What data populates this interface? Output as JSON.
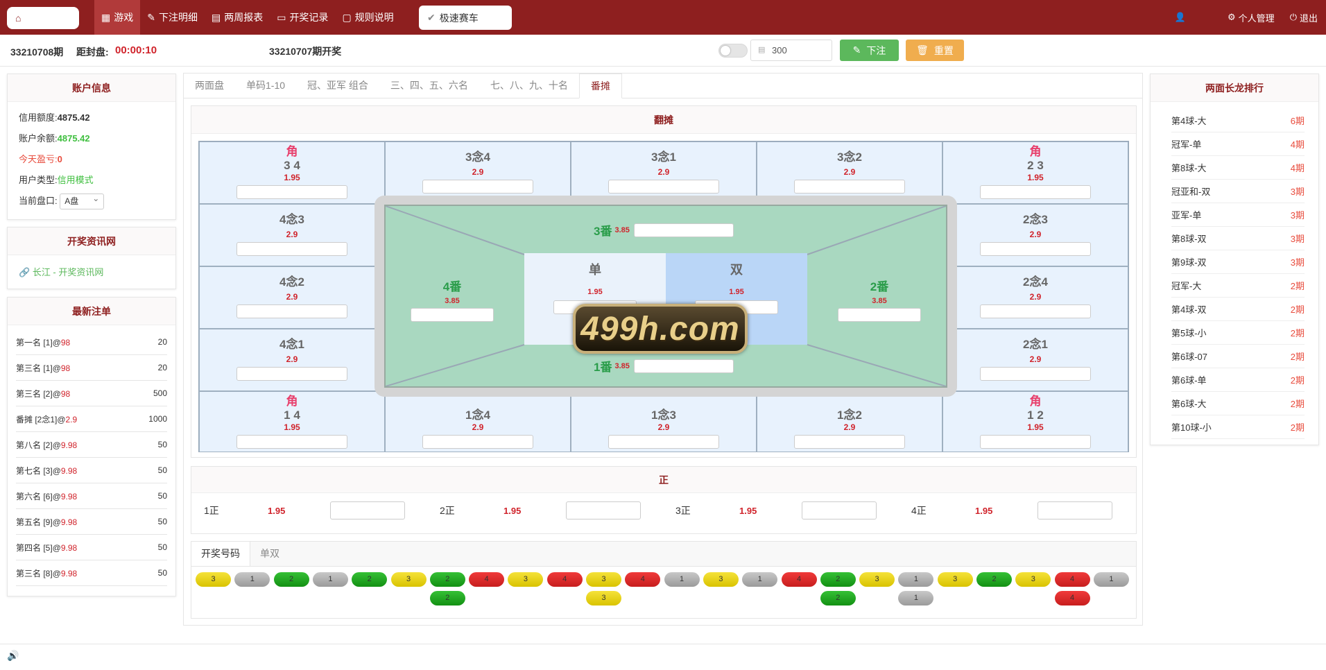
{
  "nav": {
    "items": [
      "游戏",
      "下注明细",
      "两周报表",
      "开奖记录",
      "规则说明"
    ],
    "speed": "极速赛车",
    "right": [
      "个人管理",
      "退出"
    ]
  },
  "bar": {
    "issue": "33210708期",
    "countdown_label": "距封盘:",
    "countdown": "00:00:10",
    "draw": "33210707期开奖",
    "amount": "300",
    "bet_label": "下注",
    "reset_label": "重置"
  },
  "account": {
    "title": "账户信息",
    "credit_label": "信用额度:",
    "credit": "4875.42",
    "balance_label": "账户余额:",
    "balance": "4875.42",
    "profit_label": "今天盈亏:",
    "profit": "0",
    "type_label": "用户类型:",
    "type": "信用模式",
    "market_label": "当前盘口:",
    "market": "A盘"
  },
  "news": {
    "title": "开奖资讯网",
    "link": "长江 - 开奖资讯网"
  },
  "recent": {
    "title": "最新注单",
    "items": [
      {
        "name": "第一名 [1]@",
        "odds": "98",
        "amt": "20"
      },
      {
        "name": "第三名 [1]@",
        "odds": "98",
        "amt": "20"
      },
      {
        "name": "第三名 [2]@",
        "odds": "98",
        "amt": "500"
      },
      {
        "name": "番摊 [2念1]@",
        "odds": "2.9",
        "amt": "1000"
      },
      {
        "name": "第八名 [2]@",
        "odds": "9.98",
        "amt": "50"
      },
      {
        "name": "第七名 [3]@",
        "odds": "9.98",
        "amt": "50"
      },
      {
        "name": "第六名 [6]@",
        "odds": "9.98",
        "amt": "50"
      },
      {
        "name": "第五名 [9]@",
        "odds": "9.98",
        "amt": "50"
      },
      {
        "name": "第四名 [5]@",
        "odds": "9.98",
        "amt": "50"
      },
      {
        "name": "第三名 [8]@",
        "odds": "9.98",
        "amt": "50"
      }
    ]
  },
  "tabs": [
    "两面盘",
    "单码1-10",
    "冠、亚军 组合",
    "三、四、五、六名",
    "七、八、九、十名",
    "番摊"
  ],
  "fantan": {
    "title": "翻摊",
    "jiao": "角",
    "cells": {
      "c34": {
        "label": "3 4",
        "odds": "1.95"
      },
      "c3n4": {
        "label": "3念4",
        "odds": "2.9"
      },
      "c3n1": {
        "label": "3念1",
        "odds": "2.9"
      },
      "c3n2": {
        "label": "3念2",
        "odds": "2.9"
      },
      "c23": {
        "label": "2 3",
        "odds": "1.95"
      },
      "c4n3": {
        "label": "4念3",
        "odds": "2.9"
      },
      "c2n3": {
        "label": "2念3",
        "odds": "2.9"
      },
      "c4n2": {
        "label": "4念2",
        "odds": "2.9"
      },
      "c2n4": {
        "label": "2念4",
        "odds": "2.9"
      },
      "c4n1": {
        "label": "4念1",
        "odds": "2.9"
      },
      "c2n1": {
        "label": "2念1",
        "odds": "2.9"
      },
      "c14": {
        "label": "1 4",
        "odds": "1.95"
      },
      "c1n4": {
        "label": "1念4",
        "odds": "2.9"
      },
      "c1n3": {
        "label": "1念3",
        "odds": "2.9"
      },
      "c1n2": {
        "label": "1念2",
        "odds": "2.9"
      },
      "c12": {
        "label": "1 2",
        "odds": "1.95"
      }
    },
    "fan3": {
      "label": "3番",
      "odds": "3.85"
    },
    "fan4": {
      "label": "4番",
      "odds": "3.85"
    },
    "fan2": {
      "label": "2番",
      "odds": "3.85"
    },
    "fan1": {
      "label": "1番",
      "odds": "3.85"
    },
    "dan": {
      "label": "单",
      "odds": "1.95"
    },
    "shuang": {
      "label": "双",
      "odds": "1.95"
    },
    "watermark": "499h.com"
  },
  "zheng": {
    "title": "正",
    "items": [
      {
        "name": "1正",
        "odds": "1.95"
      },
      {
        "name": "2正",
        "odds": "1.95"
      },
      {
        "name": "3正",
        "odds": "1.95"
      },
      {
        "name": "4正",
        "odds": "1.95"
      }
    ]
  },
  "results": {
    "tabs": [
      "开奖号码",
      "单双"
    ],
    "row1": [
      "3",
      "1",
      "2",
      "1",
      "2",
      "3",
      "2",
      "4",
      "3",
      "4",
      "3",
      "4",
      "1",
      "3",
      "1",
      "4",
      "2",
      "3",
      "1",
      "3",
      "2",
      "3",
      "4",
      "1"
    ],
    "row2": {
      "col6": "2",
      "col10": "3",
      "col16": "2",
      "col18": "1",
      "col22": "4"
    }
  },
  "rank": {
    "title": "两面长龙排行",
    "items": [
      {
        "name": "第4球-大",
        "n": "6期"
      },
      {
        "name": "冠军-单",
        "n": "4期"
      },
      {
        "name": "第8球-大",
        "n": "4期"
      },
      {
        "name": "冠亚和-双",
        "n": "3期"
      },
      {
        "name": "亚军-单",
        "n": "3期"
      },
      {
        "name": "第8球-双",
        "n": "3期"
      },
      {
        "name": "第9球-双",
        "n": "3期"
      },
      {
        "name": "冠军-大",
        "n": "2期"
      },
      {
        "name": "第4球-双",
        "n": "2期"
      },
      {
        "name": "第5球-小",
        "n": "2期"
      },
      {
        "name": "第6球-07",
        "n": "2期"
      },
      {
        "name": "第6球-单",
        "n": "2期"
      },
      {
        "name": "第6球-大",
        "n": "2期"
      },
      {
        "name": "第10球-小",
        "n": "2期"
      }
    ]
  }
}
